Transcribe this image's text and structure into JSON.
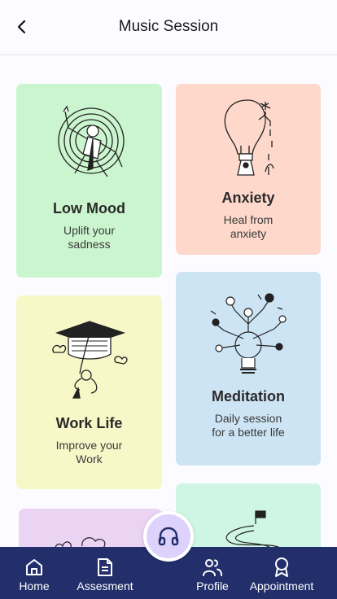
{
  "header": {
    "title": "Music Session"
  },
  "colors": {
    "low_mood": "#cbf5cf",
    "anxiety": "#fdd8cb",
    "work_life": "#f7f7c8",
    "meditation": "#cde4f4",
    "card5": "#ead3f3",
    "card6": "#cff5e4",
    "nav": "#232f6b",
    "fab": "#ddd2fb"
  },
  "cards": [
    {
      "title": "Low Mood",
      "subtitle": "Uplift your\nsadness",
      "icon": "person-swirl-icon"
    },
    {
      "title": "Anxiety",
      "subtitle": "Heal from\nanxiety",
      "icon": "lightbulb-watering-icon"
    },
    {
      "title": "Work Life",
      "subtitle": "Improve your\nWork",
      "icon": "graduation-cap-icon"
    },
    {
      "title": "Meditation",
      "subtitle": "Daily session\nfor a better life",
      "icon": "idea-bulb-tree-icon"
    }
  ],
  "nav": {
    "home": "Home",
    "assesment": "Assesment",
    "profile": "Profile",
    "appointment": "Appointment"
  }
}
